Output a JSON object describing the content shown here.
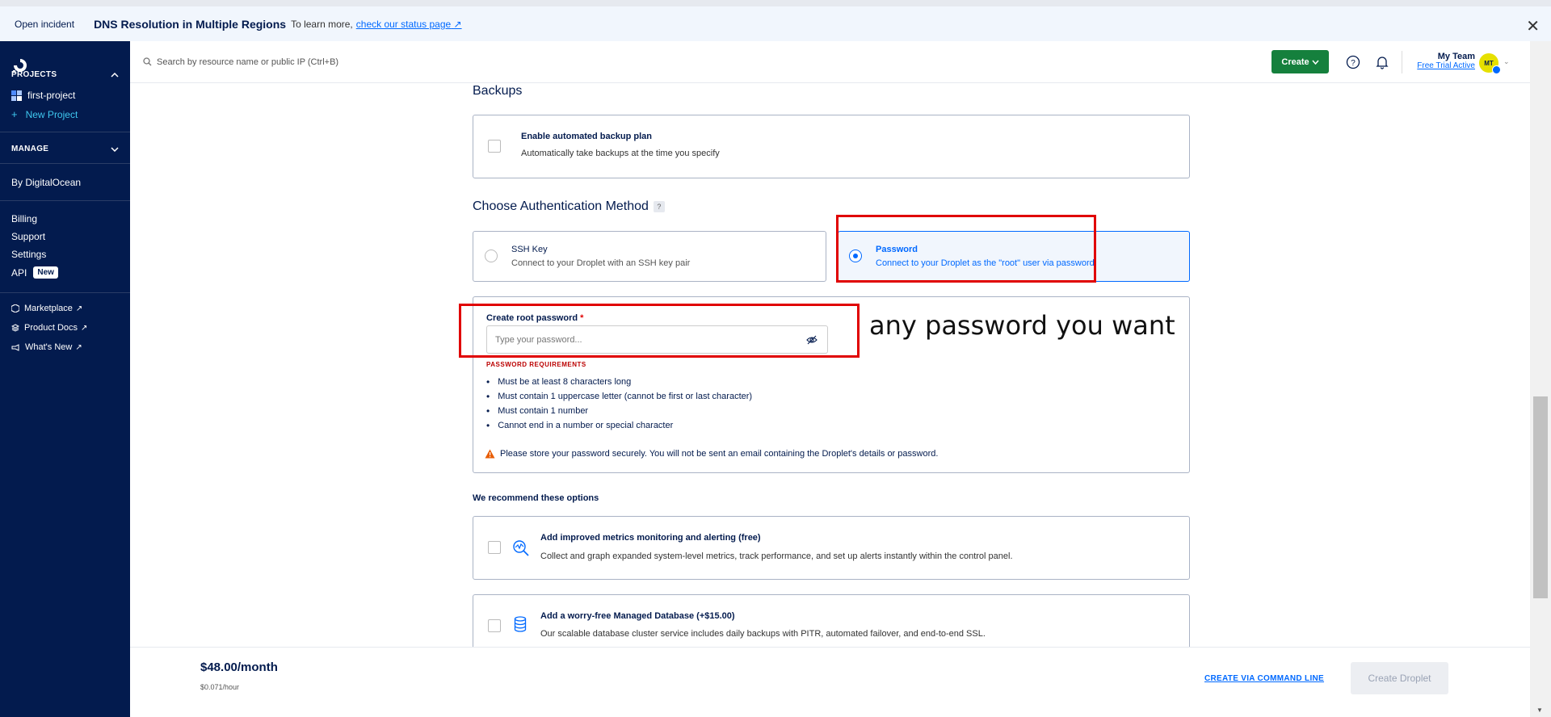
{
  "banner": {
    "label": "Open incident",
    "title": "DNS Resolution in Multiple Regions",
    "more": "To learn more,",
    "link": "check our status page",
    "link_icon": "↗",
    "close_icon": "✕"
  },
  "sidebar": {
    "projects_head": "PROJECTS",
    "project": "first-project",
    "new_project": "New Project",
    "manage_head": "MANAGE",
    "by_do": "By DigitalOcean",
    "billing": "Billing",
    "support": "Support",
    "settings": "Settings",
    "api": "API",
    "new_badge": "New",
    "marketplace": "Marketplace",
    "product_docs": "Product Docs",
    "whats_new": "What's New",
    "ext_icon": "↗"
  },
  "topbar": {
    "search_placeholder": "Search by resource name or public IP (Ctrl+B)",
    "create": "Create",
    "team_name": "My Team",
    "trial": "Free Trial Active",
    "avatar": "MT"
  },
  "backups": {
    "heading": "Backups",
    "title": "Enable automated backup plan",
    "desc": "Automatically take backups at the time you specify"
  },
  "auth": {
    "heading": "Choose Authentication Method",
    "help": "?",
    "ssh_title": "SSH Key",
    "ssh_desc": "Connect to your Droplet with an SSH key pair",
    "pw_title": "Password",
    "pw_desc": "Connect to your Droplet as the \"root\" user via password",
    "pw_label": "Create root password",
    "required": "*",
    "pw_placeholder": "Type your password...",
    "req_heading": "PASSWORD REQUIREMENTS",
    "requirements": [
      "Must be at least 8 characters long",
      "Must contain 1 uppercase letter (cannot be first or last character)",
      "Must contain 1 number",
      "Cannot end in a number or special character"
    ],
    "warning": "Please store your password securely. You will not be sent an email containing the Droplet's details or password."
  },
  "annotation": "any password you want",
  "recommend": {
    "heading": "We recommend these options",
    "metrics_title": "Add improved metrics monitoring and alerting (free)",
    "metrics_desc": "Collect and graph expanded system-level metrics, track performance, and set up alerts instantly within the control panel.",
    "db_title": "Add a worry-free Managed Database (+$15.00)",
    "db_desc": "Our scalable database cluster service includes daily backups with PITR, automated failover, and end-to-end SSL."
  },
  "footer": {
    "price": "$48.00/month",
    "hourly": "$0.071/hour",
    "cli": "CREATE VIA COMMAND LINE",
    "create_droplet": "Create Droplet"
  },
  "colors": {
    "sidebar_bg": "#031b4e",
    "accent": "#0069ff",
    "create_green": "#15803d",
    "highlight_red": "#e00000",
    "new_project_cyan": "#3fc8f0"
  }
}
